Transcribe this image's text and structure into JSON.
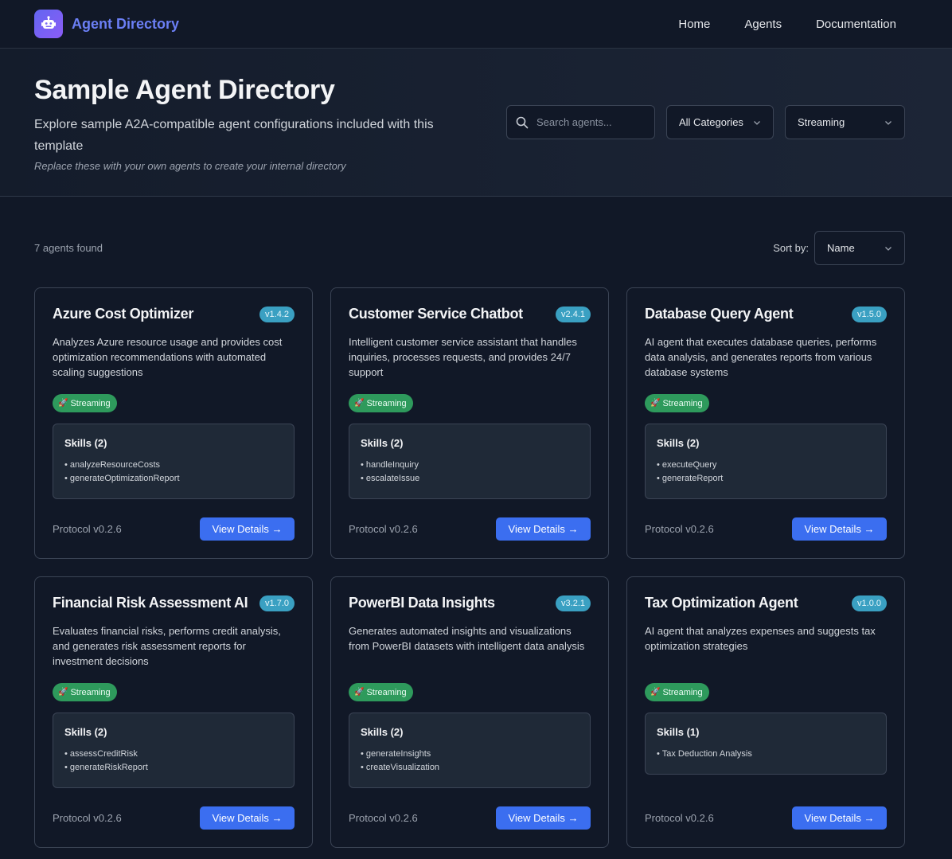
{
  "nav": {
    "brand": "Agent Directory",
    "links": [
      "Home",
      "Agents",
      "Documentation"
    ]
  },
  "hero": {
    "title": "Sample Agent Directory",
    "subtitle": "Explore sample A2A-compatible agent configurations included with this template",
    "note": "Replace these with your own agents to create your internal directory"
  },
  "filters": {
    "search_placeholder": "Search agents...",
    "category": "All Categories",
    "capability": "Streaming"
  },
  "results": {
    "count_text": "7 agents found",
    "sort_label": "Sort by:",
    "sort_value": "Name"
  },
  "colors": {
    "accent": "#3b6ef0",
    "version_badge": "#3aa0c2",
    "streaming_badge": "#2e9a5c",
    "brand": "#6b7ff5"
  },
  "cards": [
    {
      "title": "Azure Cost Optimizer",
      "version": "v1.4.2",
      "description": "Analyzes Azure resource usage and provides cost optimization recommendations with automated scaling suggestions",
      "badge": "Streaming",
      "skills_title": "Skills (2)",
      "skills": [
        "analyzeResourceCosts",
        "generateOptimizationReport"
      ],
      "protocol": "Protocol v0.2.6",
      "button": "View Details →"
    },
    {
      "title": "Customer Service Chatbot",
      "version": "v2.4.1",
      "description": "Intelligent customer service assistant that handles inquiries, processes requests, and provides 24/7 support",
      "badge": "Streaming",
      "skills_title": "Skills (2)",
      "skills": [
        "handleInquiry",
        "escalateIssue"
      ],
      "protocol": "Protocol v0.2.6",
      "button": "View Details →"
    },
    {
      "title": "Database Query Agent",
      "version": "v1.5.0",
      "description": "AI agent that executes database queries, performs data analysis, and generates reports from various database systems",
      "badge": "Streaming",
      "skills_title": "Skills (2)",
      "skills": [
        "executeQuery",
        "generateReport"
      ],
      "protocol": "Protocol v0.2.6",
      "button": "View Details →"
    },
    {
      "title": "Financial Risk Assessment AI",
      "version": "v1.7.0",
      "description": "Evaluates financial risks, performs credit analysis, and generates risk assessment reports for investment decisions",
      "badge": "Streaming",
      "skills_title": "Skills (2)",
      "skills": [
        "assessCreditRisk",
        "generateRiskReport"
      ],
      "protocol": "Protocol v0.2.6",
      "button": "View Details →"
    },
    {
      "title": "PowerBI Data Insights",
      "version": "v3.2.1",
      "description": "Generates automated insights and visualizations from PowerBI datasets with intelligent data analysis",
      "badge": "Streaming",
      "skills_title": "Skills (2)",
      "skills": [
        "generateInsights",
        "createVisualization"
      ],
      "protocol": "Protocol v0.2.6",
      "button": "View Details →"
    },
    {
      "title": "Tax Optimization Agent",
      "version": "v1.0.0",
      "description": "AI agent that analyzes expenses and suggests tax optimization strategies",
      "badge": "Streaming",
      "skills_title": "Skills (1)",
      "skills": [
        "Tax Deduction Analysis"
      ],
      "protocol": "Protocol v0.2.6",
      "button": "View Details →"
    }
  ]
}
